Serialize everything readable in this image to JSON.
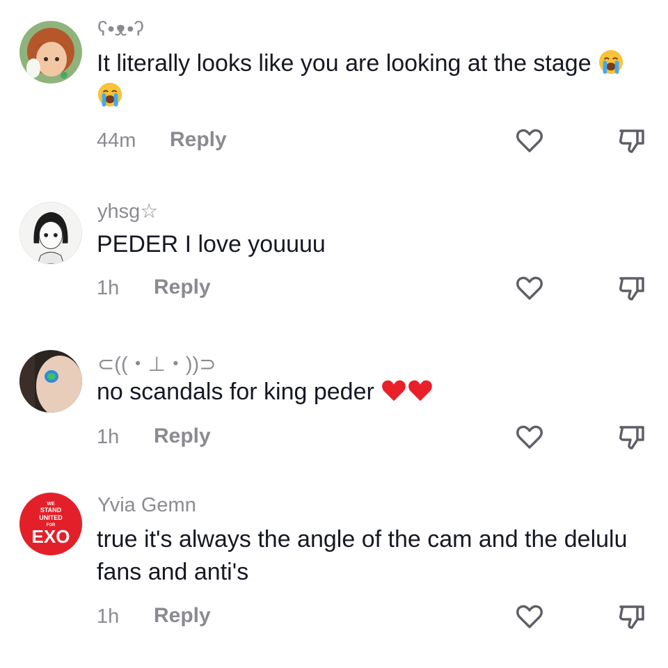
{
  "comments": [
    {
      "username": "ʕ•ᴥ•ʔ",
      "text": "It literally looks like you are looking at the stage",
      "emoji": [
        "crying-face",
        "crying-face"
      ],
      "time": "44m",
      "reply_label": "Reply",
      "avatar": "avatar-animated-princess"
    },
    {
      "username": "yhsg☆",
      "text": "PEDER I love youuuu",
      "emoji": [],
      "time": "1h",
      "reply_label": "Reply",
      "avatar": "avatar-manga-girl"
    },
    {
      "username": "⊂((・⊥・))⊃",
      "text": "no scandals for king peder",
      "emoji": [
        "red-heart",
        "red-heart"
      ],
      "time": "1h",
      "reply_label": "Reply",
      "avatar": "avatar-face-paint"
    },
    {
      "username": "Yvia Gemn",
      "text": "true it's always the angle of the cam and the delulu fans and anti's",
      "emoji": [],
      "time": "1h",
      "reply_label": "Reply",
      "avatar": "avatar-exo-badge",
      "avatar_text": [
        "WE",
        "STAND",
        "UNITED",
        "FOR",
        "EXO"
      ]
    }
  ],
  "colors": {
    "text": "#161823",
    "secondary": "#8a8b91",
    "icon": "#5e5f66",
    "badge_red": "#e3202a"
  }
}
